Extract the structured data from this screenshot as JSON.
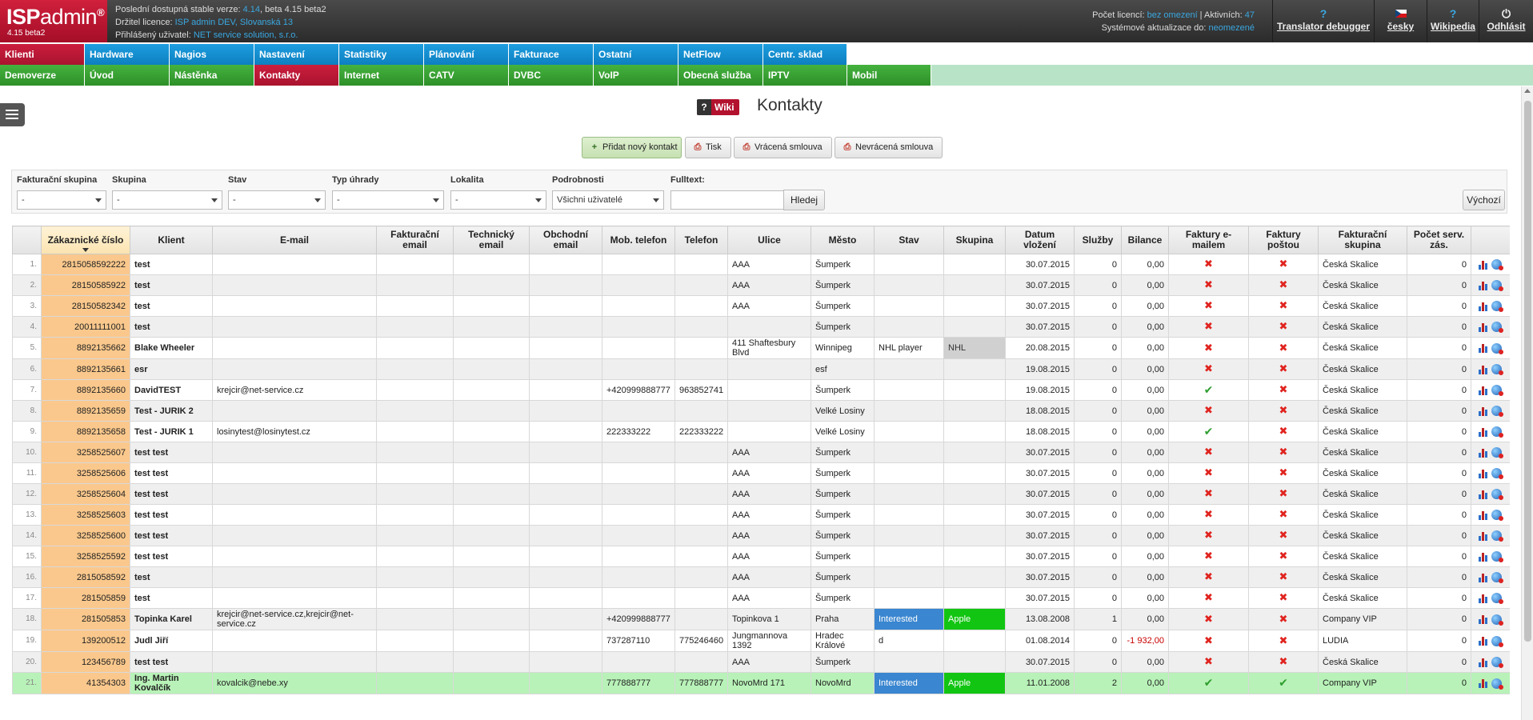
{
  "header": {
    "logo_isp": "ISP",
    "logo_admin": "admin",
    "logo_reg": "®",
    "version": "4.15 beta2",
    "stable_prefix": "Poslední dostupná stable verze:",
    "stable_version": "4.14",
    "stable_suffix": ", beta 4.15 beta2",
    "licence_prefix": "Držitel licence:",
    "licence_holder": "ISP admin DEV, Slovanská 13",
    "user_prefix": "Přihlášený uživatel:",
    "user_name": "NET service solution, s.r.o.",
    "licences_prefix": "Počet licencí:",
    "licences_value": "bez omezení",
    "active_prefix": "Aktivních:",
    "active_value": "47",
    "updates_prefix": "Systémové aktualizace do:",
    "updates_value": "neomezené"
  },
  "tools": {
    "translator_icon": "?",
    "translator": "Translator debugger",
    "language": "česky",
    "wiki_icon": "?",
    "wikipedia": "Wikipedia",
    "logout_icon": "⏻",
    "logout": "Odhlásit"
  },
  "menu1": [
    {
      "label": "Klienti",
      "color": "red"
    },
    {
      "label": "Hardware",
      "color": "blue"
    },
    {
      "label": "Nagios",
      "color": "blue"
    },
    {
      "label": "Nastavení",
      "color": "blue"
    },
    {
      "label": "Statistiky",
      "color": "blue"
    },
    {
      "label": "Plánování",
      "color": "blue"
    },
    {
      "label": "Fakturace",
      "color": "blue"
    },
    {
      "label": "Ostatní",
      "color": "blue"
    },
    {
      "label": "NetFlow",
      "color": "blue"
    },
    {
      "label": "Centr. sklad",
      "color": "blue"
    }
  ],
  "menu2": [
    {
      "label": "Demoverze",
      "color": "green"
    },
    {
      "label": "Úvod",
      "color": "green"
    },
    {
      "label": "Nástěnka",
      "color": "green"
    },
    {
      "label": "Kontakty",
      "color": "red"
    },
    {
      "label": "Internet",
      "color": "green"
    },
    {
      "label": "CATV",
      "color": "green"
    },
    {
      "label": "DVBC",
      "color": "green"
    },
    {
      "label": "VoIP",
      "color": "green"
    },
    {
      "label": "Obecná služba",
      "color": "green"
    },
    {
      "label": "IPTV",
      "color": "green"
    },
    {
      "label": "Mobil",
      "color": "green"
    }
  ],
  "page": {
    "wiki_q": "?",
    "wiki_label": "Wiki",
    "title": "Kontakty"
  },
  "actions": {
    "add_icon": "+",
    "add": "Přidat nový kontakt",
    "print": "Tisk",
    "returned": "Vrácená smlouva",
    "not_returned": "Nevrácená smlouva"
  },
  "filters": {
    "billing_group_label": "Fakturační skupina",
    "billing_group_value": "-",
    "group_label": "Skupina",
    "group_value": "-",
    "status_label": "Stav",
    "status_value": "-",
    "payment_label": "Typ úhrady",
    "payment_value": "-",
    "locality_label": "Lokalita",
    "locality_value": "-",
    "details_label": "Podrobnosti",
    "details_value": "Všichni uživatelé",
    "fulltext_label": "Fulltext:",
    "fulltext_value": "",
    "search": "Hledej",
    "default": "Výchozí"
  },
  "table": {
    "headers": [
      "",
      "Zákaznické číslo",
      "Klient",
      "E-mail",
      "Fakturační email",
      "Technický email",
      "Obchodní email",
      "Mob. telefon",
      "Telefon",
      "Ulice",
      "Město",
      "Stav",
      "Skupina",
      "Datum vložení",
      "Služby",
      "Bilance",
      "Faktury e-mailem",
      "Faktury poštou",
      "Fakturační skupina",
      "Počet serv. zás.",
      ""
    ],
    "rows": [
      {
        "n": "1.",
        "cust": "2815058592222",
        "client": "test",
        "email": "",
        "mob": "",
        "tel": "",
        "street": "AAA",
        "city": "Šumperk",
        "status": "",
        "group": "",
        "date": "30.07.2015",
        "services": "0",
        "balance": "0,00",
        "inv_email": "x",
        "inv_post": "x",
        "billing_group": "Česká Skalice",
        "srv": "0"
      },
      {
        "n": "2.",
        "cust": "28150585922",
        "client": "test",
        "email": "",
        "mob": "",
        "tel": "",
        "street": "AAA",
        "city": "Šumperk",
        "status": "",
        "group": "",
        "date": "30.07.2015",
        "services": "0",
        "balance": "0,00",
        "inv_email": "x",
        "inv_post": "x",
        "billing_group": "Česká Skalice",
        "srv": "0"
      },
      {
        "n": "3.",
        "cust": "28150582342",
        "client": "test",
        "email": "",
        "mob": "",
        "tel": "",
        "street": "AAA",
        "city": "Šumperk",
        "status": "",
        "group": "",
        "date": "30.07.2015",
        "services": "0",
        "balance": "0,00",
        "inv_email": "x",
        "inv_post": "x",
        "billing_group": "Česká Skalice",
        "srv": "0"
      },
      {
        "n": "4.",
        "cust": "20011111001",
        "client": "test",
        "email": "",
        "mob": "",
        "tel": "",
        "street": "",
        "city": "Šumperk",
        "status": "",
        "group": "",
        "date": "30.07.2015",
        "services": "0",
        "balance": "0,00",
        "inv_email": "x",
        "inv_post": "x",
        "billing_group": "Česká Skalice",
        "srv": "0"
      },
      {
        "n": "5.",
        "cust": "8892135662",
        "client": "Blake Wheeler",
        "email": "",
        "mob": "",
        "tel": "",
        "street": "411 Shaftesbury Blvd",
        "city": "Winnipeg",
        "status": "NHL player",
        "group": "NHL",
        "date": "20.08.2015",
        "services": "0",
        "balance": "0,00",
        "inv_email": "x",
        "inv_post": "x",
        "billing_group": "Česká Skalice",
        "srv": "0",
        "group_style": "grey"
      },
      {
        "n": "6.",
        "cust": "8892135661",
        "client": "esr",
        "email": "",
        "mob": "",
        "tel": "",
        "street": "",
        "city": "esf",
        "status": "",
        "group": "",
        "date": "19.08.2015",
        "services": "0",
        "balance": "0,00",
        "inv_email": "x",
        "inv_post": "x",
        "billing_group": "Česká Skalice",
        "srv": "0"
      },
      {
        "n": "7.",
        "cust": "8892135660",
        "client": "DavidTEST",
        "email": "krejcir@net-service.cz",
        "mob": "+420999888777",
        "tel": "963852741",
        "street": "",
        "city": "Šumperk",
        "status": "",
        "group": "",
        "date": "19.08.2015",
        "services": "0",
        "balance": "0,00",
        "inv_email": "ok",
        "inv_post": "x",
        "billing_group": "Česká Skalice",
        "srv": "0"
      },
      {
        "n": "8.",
        "cust": "8892135659",
        "client": "Test - JURIK 2",
        "email": "",
        "mob": "",
        "tel": "",
        "street": "",
        "city": "Velké Losiny",
        "status": "",
        "group": "",
        "date": "18.08.2015",
        "services": "0",
        "balance": "0,00",
        "inv_email": "x",
        "inv_post": "x",
        "billing_group": "Česká Skalice",
        "srv": "0"
      },
      {
        "n": "9.",
        "cust": "8892135658",
        "client": "Test - JURIK 1",
        "email": "losinytest@losinytest.cz",
        "mob": "222333222",
        "tel": "222333222",
        "street": "",
        "city": "Velké Losiny",
        "status": "",
        "group": "",
        "date": "18.08.2015",
        "services": "0",
        "balance": "0,00",
        "inv_email": "ok",
        "inv_post": "x",
        "billing_group": "Česká Skalice",
        "srv": "0"
      },
      {
        "n": "10.",
        "cust": "3258525607",
        "client": "test test",
        "email": "",
        "mob": "",
        "tel": "",
        "street": "AAA",
        "city": "Šumperk",
        "status": "",
        "group": "",
        "date": "30.07.2015",
        "services": "0",
        "balance": "0,00",
        "inv_email": "x",
        "inv_post": "x",
        "billing_group": "Česká Skalice",
        "srv": "0"
      },
      {
        "n": "11.",
        "cust": "3258525606",
        "client": "test test",
        "email": "",
        "mob": "",
        "tel": "",
        "street": "AAA",
        "city": "Šumperk",
        "status": "",
        "group": "",
        "date": "30.07.2015",
        "services": "0",
        "balance": "0,00",
        "inv_email": "x",
        "inv_post": "x",
        "billing_group": "Česká Skalice",
        "srv": "0"
      },
      {
        "n": "12.",
        "cust": "3258525604",
        "client": "test test",
        "email": "",
        "mob": "",
        "tel": "",
        "street": "AAA",
        "city": "Šumperk",
        "status": "",
        "group": "",
        "date": "30.07.2015",
        "services": "0",
        "balance": "0,00",
        "inv_email": "x",
        "inv_post": "x",
        "billing_group": "Česká Skalice",
        "srv": "0"
      },
      {
        "n": "13.",
        "cust": "3258525603",
        "client": "test test",
        "email": "",
        "mob": "",
        "tel": "",
        "street": "AAA",
        "city": "Šumperk",
        "status": "",
        "group": "",
        "date": "30.07.2015",
        "services": "0",
        "balance": "0,00",
        "inv_email": "x",
        "inv_post": "x",
        "billing_group": "Česká Skalice",
        "srv": "0"
      },
      {
        "n": "14.",
        "cust": "3258525600",
        "client": "test test",
        "email": "",
        "mob": "",
        "tel": "",
        "street": "AAA",
        "city": "Šumperk",
        "status": "",
        "group": "",
        "date": "30.07.2015",
        "services": "0",
        "balance": "0,00",
        "inv_email": "x",
        "inv_post": "x",
        "billing_group": "Česká Skalice",
        "srv": "0"
      },
      {
        "n": "15.",
        "cust": "3258525592",
        "client": "test test",
        "email": "",
        "mob": "",
        "tel": "",
        "street": "AAA",
        "city": "Šumperk",
        "status": "",
        "group": "",
        "date": "30.07.2015",
        "services": "0",
        "balance": "0,00",
        "inv_email": "x",
        "inv_post": "x",
        "billing_group": "Česká Skalice",
        "srv": "0"
      },
      {
        "n": "16.",
        "cust": "2815058592",
        "client": "test",
        "email": "",
        "mob": "",
        "tel": "",
        "street": "AAA",
        "city": "Šumperk",
        "status": "",
        "group": "",
        "date": "30.07.2015",
        "services": "0",
        "balance": "0,00",
        "inv_email": "x",
        "inv_post": "x",
        "billing_group": "Česká Skalice",
        "srv": "0"
      },
      {
        "n": "17.",
        "cust": "281505859",
        "client": "test",
        "email": "",
        "mob": "",
        "tel": "",
        "street": "AAA",
        "city": "Šumperk",
        "status": "",
        "group": "",
        "date": "30.07.2015",
        "services": "0",
        "balance": "0,00",
        "inv_email": "x",
        "inv_post": "x",
        "billing_group": "Česká Skalice",
        "srv": "0"
      },
      {
        "n": "18.",
        "cust": "281505853",
        "client": "Topinka Karel",
        "email": "krejcir@net-service.cz,krejcir@net-service.cz",
        "mob": "+420999888777",
        "tel": "",
        "street": "Topinkova 1",
        "city": "Praha",
        "status": "Interested",
        "group": "Apple",
        "date": "13.08.2008",
        "services": "1",
        "balance": "0,00",
        "inv_email": "x",
        "inv_post": "x",
        "billing_group": "Company VIP",
        "srv": "0",
        "status_style": "blue",
        "group_style": "green"
      },
      {
        "n": "19.",
        "cust": "139200512",
        "client": "Judl Jiří",
        "email": "",
        "mob": "737287110",
        "tel": "775246460",
        "street": "Jungmannova 1392",
        "city": "Hradec Králové",
        "status": "d",
        "group": "",
        "date": "01.08.2014",
        "services": "0",
        "balance": "-1 932,00",
        "inv_email": "x",
        "inv_post": "x",
        "billing_group": "LUDIA",
        "srv": "0",
        "neg": true
      },
      {
        "n": "20.",
        "cust": "123456789",
        "client": "test test",
        "email": "",
        "mob": "",
        "tel": "",
        "street": "AAA",
        "city": "Šumperk",
        "status": "",
        "group": "",
        "date": "30.07.2015",
        "services": "0",
        "balance": "0,00",
        "inv_email": "x",
        "inv_post": "x",
        "billing_group": "Česká Skalice",
        "srv": "0"
      },
      {
        "n": "21.",
        "cust": "41354303",
        "client": "Ing. Martin Kovalčík",
        "email": "kovalcik@nebe.xy",
        "mob": "777888777",
        "tel": "777888777",
        "street": "NovoMrd 171",
        "city": "NovoMrd",
        "status": "Interested",
        "group": "Apple",
        "date": "11.01.2008",
        "services": "2",
        "balance": "0,00",
        "inv_email": "ok",
        "inv_post": "ok",
        "billing_group": "Company VIP",
        "srv": "0",
        "status_style": "blue",
        "group_style": "green",
        "highlight": true
      }
    ]
  }
}
